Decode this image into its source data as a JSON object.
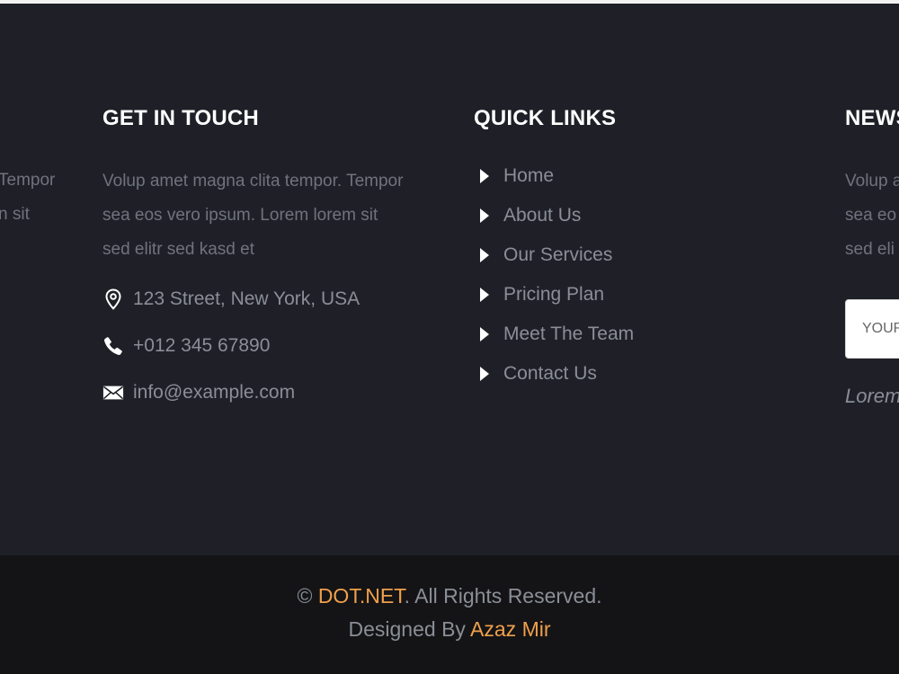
{
  "left_column": {
    "text_lines": [
      "Tempor",
      "n sit"
    ]
  },
  "get_in_touch": {
    "title": "GET IN TOUCH",
    "description_lines": [
      "Volup amet magna clita tempor. Tempor",
      "sea eos vero ipsum. Lorem lorem sit",
      "sed elitr sed kasd et"
    ],
    "address": "123 Street, New York, USA",
    "phone": "+012 345 67890",
    "email": "info@example.com",
    "icons": [
      "map-pin-icon",
      "phone-icon",
      "envelope-icon"
    ]
  },
  "quick_links": {
    "title": "QUICK LINKS",
    "items": [
      {
        "label": "Home"
      },
      {
        "label": "About Us"
      },
      {
        "label": "Our Services"
      },
      {
        "label": "Pricing Plan"
      },
      {
        "label": "Meet The Team"
      },
      {
        "label": "Contact Us"
      }
    ],
    "icon": "caret-right-icon"
  },
  "newsletter": {
    "title": "NEWS",
    "description_lines": [
      "Volup a",
      "sea eo",
      "sed eli"
    ],
    "input_placeholder": "YOUR",
    "note": "Lorem"
  },
  "copyright": {
    "symbol": "©",
    "brand": "DOT.NET",
    "rights": ". All Rights Reserved.",
    "designed_by": "Designed By",
    "designer": "Azaz Mir"
  },
  "colors": {
    "footer_bg": "#1f2027",
    "copyright_bg": "#141416",
    "heading": "#ffffff",
    "muted_text": "#6f737d",
    "link_text": "#8a8e97",
    "accent": "#f0a04b"
  }
}
